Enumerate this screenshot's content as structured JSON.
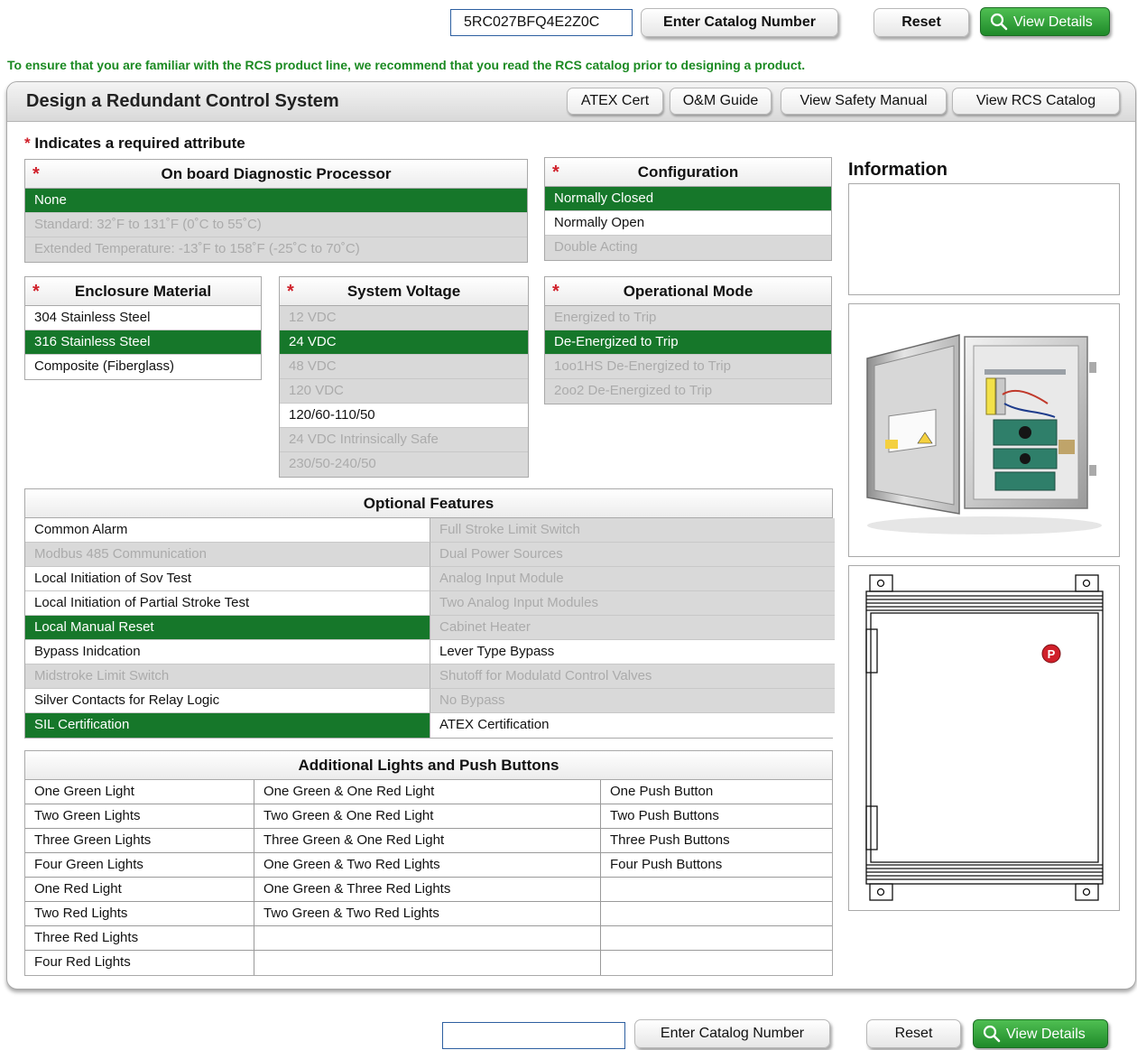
{
  "top_bar": {
    "catalog_value": "5RC027BFQ4E2Z0C",
    "enter_label": "Enter Catalog Number",
    "reset_label": "Reset",
    "view_label": "View Details"
  },
  "bottom_bar": {
    "catalog_value": "",
    "enter_label": "Enter Catalog Number",
    "reset_label": "Reset",
    "view_label": "View Details"
  },
  "notice": "To ensure that you are familiar with the RCS product line, we recommend that you read the RCS catalog prior to designing a product.",
  "panel": {
    "title": "Design a Redundant Control System",
    "links": [
      "ATEX Cert",
      "O&M Guide",
      "View Safety Manual",
      "View RCS Catalog"
    ]
  },
  "required_note": "Indicates a required attribute",
  "attributes": {
    "diag": {
      "title": "On board Diagnostic Processor",
      "options": [
        {
          "label": "None",
          "state": "sel"
        },
        {
          "label": "Standard: 32˚F to 131˚F (0˚C to 55˚C)",
          "state": "dis"
        },
        {
          "label": "Extended Temperature: -13˚F to 158˚F (-25˚C to 70˚C)",
          "state": "dis"
        }
      ]
    },
    "config": {
      "title": "Configuration",
      "options": [
        {
          "label": "Normally Closed",
          "state": "sel"
        },
        {
          "label": "Normally Open",
          "state": "av"
        },
        {
          "label": "Double Acting",
          "state": "dis"
        }
      ]
    },
    "enclosure": {
      "title": "Enclosure Material",
      "options": [
        {
          "label": "304 Stainless Steel",
          "state": "av"
        },
        {
          "label": "316 Stainless Steel",
          "state": "sel"
        },
        {
          "label": "Composite (Fiberglass)",
          "state": "av"
        }
      ]
    },
    "voltage": {
      "title": "System Voltage",
      "options": [
        {
          "label": "12 VDC",
          "state": "dis"
        },
        {
          "label": "24 VDC",
          "state": "sel"
        },
        {
          "label": "48 VDC",
          "state": "dis"
        },
        {
          "label": "120 VDC",
          "state": "dis"
        },
        {
          "label": "120/60-110/50",
          "state": "av"
        },
        {
          "label": "24 VDC Intrinsically Safe",
          "state": "dis"
        },
        {
          "label": "230/50-240/50",
          "state": "dis"
        }
      ]
    },
    "mode": {
      "title": "Operational Mode",
      "options": [
        {
          "label": "Energized to Trip",
          "state": "dis"
        },
        {
          "label": "De-Energized to Trip",
          "state": "sel"
        },
        {
          "label": "1oo1HS De-Energized to Trip",
          "state": "dis"
        },
        {
          "label": "2oo2 De-Energized to Trip",
          "state": "dis"
        }
      ]
    }
  },
  "optional_features": {
    "title": "Optional Features",
    "options": [
      {
        "label": "Common Alarm",
        "state": "av"
      },
      {
        "label": "Full Stroke Limit Switch",
        "state": "dis"
      },
      {
        "label": "Modbus 485 Communication",
        "state": "dis"
      },
      {
        "label": "Dual Power Sources",
        "state": "dis"
      },
      {
        "label": "Local Initiation of Sov Test",
        "state": "av"
      },
      {
        "label": "Analog Input Module",
        "state": "dis"
      },
      {
        "label": "Local Initiation of Partial Stroke Test",
        "state": "av"
      },
      {
        "label": "Two Analog Input Modules",
        "state": "dis"
      },
      {
        "label": "Local Manual Reset",
        "state": "sel"
      },
      {
        "label": "Cabinet Heater",
        "state": "dis"
      },
      {
        "label": "Bypass Inidcation",
        "state": "av"
      },
      {
        "label": "Lever Type Bypass",
        "state": "av"
      },
      {
        "label": "Midstroke Limit Switch",
        "state": "dis"
      },
      {
        "label": "Shutoff for Modulatd Control Valves",
        "state": "dis"
      },
      {
        "label": "Silver Contacts for Relay Logic",
        "state": "av"
      },
      {
        "label": "No Bypass",
        "state": "dis"
      },
      {
        "label": "SIL Certification",
        "state": "sel"
      },
      {
        "label": "ATEX Certification",
        "state": "av"
      }
    ]
  },
  "lights": {
    "title": "Additional Lights and Push Buttons",
    "rows": [
      [
        "One Green Light",
        "One Green & One Red Light",
        "One Push Button"
      ],
      [
        "Two Green Lights",
        "Two Green & One Red Light",
        "Two  Push Buttons"
      ],
      [
        "Three Green Lights",
        "Three Green & One Red Light",
        "Three Push Buttons"
      ],
      [
        "Four Green Lights",
        "One Green & Two Red Lights",
        "Four Push Buttons"
      ],
      [
        "One Red Light",
        "One Green & Three Red Lights",
        ""
      ],
      [
        "Two Red Lights",
        "Two Green & Two Red Lights",
        ""
      ],
      [
        "Three Red Lights",
        "",
        ""
      ],
      [
        "Four Red Lights",
        "",
        ""
      ]
    ]
  },
  "information": {
    "title": "Information",
    "text": ""
  },
  "drawing": {
    "badge": "P"
  },
  "colors": {
    "selected": "#16772a",
    "disabled": "#d9d9d9",
    "required_star": "#d0202a",
    "notice": "#1b8a22",
    "view_button": "#1f8a2a"
  }
}
